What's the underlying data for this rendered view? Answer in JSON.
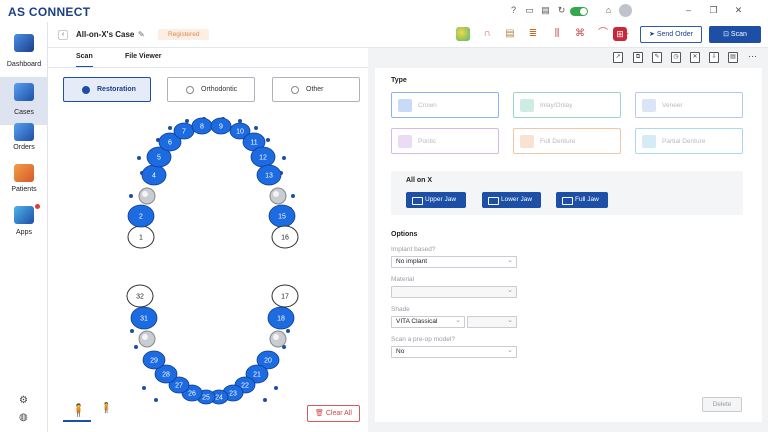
{
  "app": {
    "title": "AS CONNECT",
    "window_controls": [
      "help-icon",
      "message-icon",
      "calendar-icon",
      "sync-icon",
      "toggle",
      "home-icon",
      "user-avatar",
      "minimize-icon",
      "maximize-icon",
      "close-icon"
    ]
  },
  "sidebar": {
    "items": [
      {
        "label": "Dashboard",
        "icon": "dashboard-icon",
        "active": false
      },
      {
        "label": "Cases",
        "icon": "cases-icon",
        "active": true
      },
      {
        "label": "Orders",
        "icon": "orders-icon",
        "active": false
      },
      {
        "label": "Patients",
        "icon": "patients-icon",
        "active": false
      },
      {
        "label": "Apps",
        "icon": "apps-icon",
        "active": false
      }
    ]
  },
  "case": {
    "title": "All-on-X's Case",
    "status": "Registered",
    "send_order_label": "Send Order",
    "scan_label": "Scan"
  },
  "tabs": [
    {
      "label": "Scan",
      "active": true
    },
    {
      "label": "File Viewer",
      "active": false
    }
  ],
  "modes": [
    {
      "label": "Restoration",
      "selected": true
    },
    {
      "label": "Orthodontic",
      "selected": false
    },
    {
      "label": "Other",
      "selected": false
    }
  ],
  "teeth": {
    "upper": [
      "1",
      "2",
      "4",
      "5",
      "6",
      "7",
      "8",
      "9",
      "10",
      "11",
      "12",
      "13",
      "15",
      "16"
    ],
    "lower": [
      "17",
      "18",
      "20",
      "21",
      "22",
      "23",
      "24",
      "25",
      "26",
      "27",
      "28",
      "29",
      "31",
      "32"
    ],
    "outlined": [
      "1",
      "16",
      "17",
      "32"
    ],
    "implant_positions": [
      "3",
      "14",
      "19",
      "30"
    ]
  },
  "clear_all_label": "Clear All",
  "type_section": {
    "title": "Type",
    "cards": [
      {
        "label": "Crown",
        "color": "#8db4ea"
      },
      {
        "label": "Inlay/Onlay",
        "color": "#9ad6c8"
      },
      {
        "label": "Veneer",
        "color": "#b5c8ef"
      },
      {
        "label": "Pontic",
        "color": "#d7b8e9"
      },
      {
        "label": "Full Denture",
        "color": "#f0c6a5"
      },
      {
        "label": "Partial Denture",
        "color": "#a9d8ef"
      }
    ]
  },
  "all_on_x": {
    "title": "All on X",
    "buttons": [
      "Upper Jaw",
      "Lower Jaw",
      "Full Jaw"
    ]
  },
  "options": {
    "title": "Options",
    "implant_based_label": "Implant based?",
    "implant_based_value": "No implant",
    "material_label": "Material",
    "material_value": "",
    "shade_label": "Shade",
    "shade_value": "VITA Classical",
    "shade_value_2": "",
    "preop_label": "Scan a pre-op model?",
    "preop_value": "No"
  },
  "delete_label": "Delete",
  "colors": {
    "brand": "#1d4fa6",
    "tooth_fill": "#1d6be0",
    "accent_green": "#33a94c"
  }
}
